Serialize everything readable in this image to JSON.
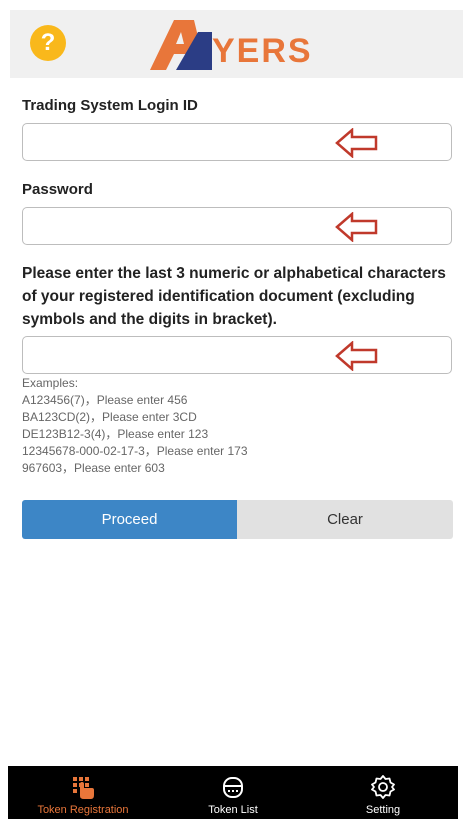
{
  "header": {
    "help_icon": "question-circle-icon",
    "logo_text": "AYERS"
  },
  "form": {
    "login_label": "Trading System Login ID",
    "login_value": "",
    "password_label": "Password",
    "password_value": "",
    "instruction": "Please enter the last 3 numeric or alphabetical characters of your registered identification document (excluding symbols and the digits in bracket).",
    "id_value": "",
    "examples": [
      "Examples:",
      "A123456(7)，Please enter 456",
      "BA123CD(2)，Please enter 3CD",
      "DE123B12-3(4)，Please enter 123",
      "12345678-000-02-17-3，Please enter 173",
      "967603，Please enter 603"
    ]
  },
  "buttons": {
    "proceed": "Proceed",
    "clear": "Clear"
  },
  "nav": [
    {
      "label": "Token Registration",
      "icon": "token-registration-icon",
      "active": true
    },
    {
      "label": "Token List",
      "icon": "token-list-icon",
      "active": false
    },
    {
      "label": "Setting",
      "icon": "gear-icon",
      "active": false
    }
  ],
  "colors": {
    "accent_orange": "#e8763a",
    "logo_blue": "#2b3d85",
    "help_yellow": "#f9b81b",
    "proceed_blue": "#3d86c6",
    "arrow_red": "#c0392b"
  }
}
